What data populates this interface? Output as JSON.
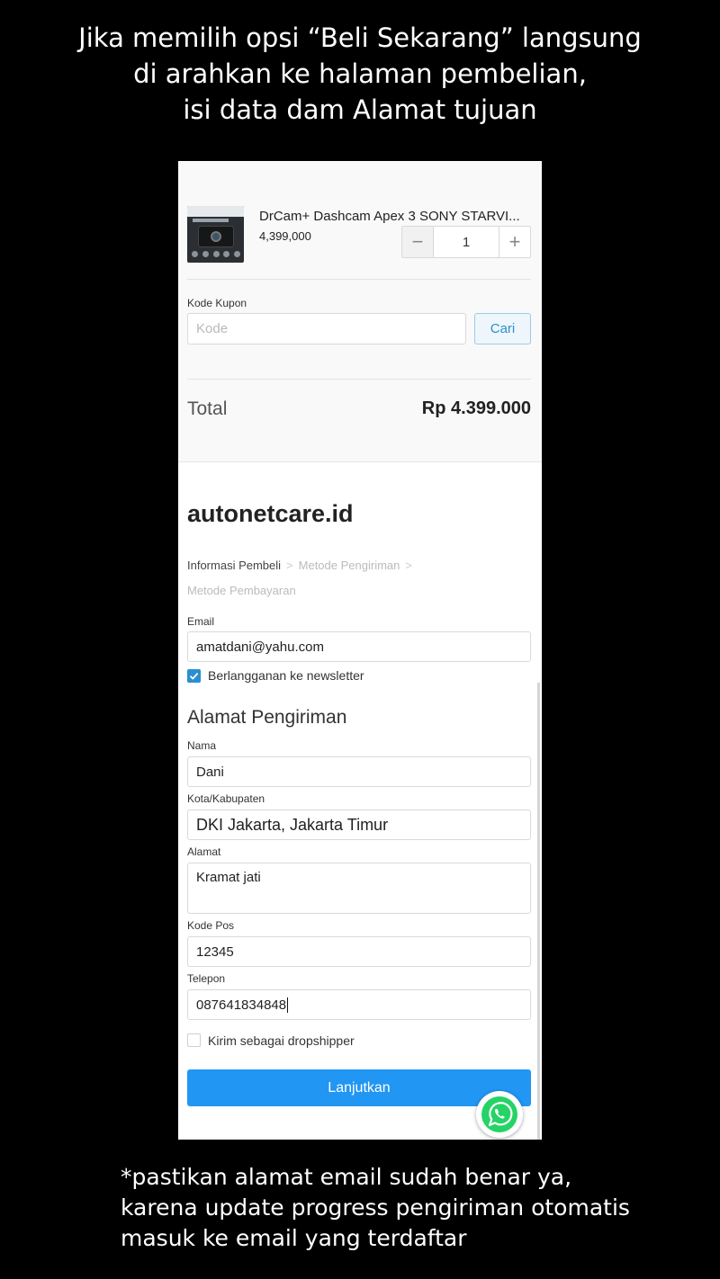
{
  "captions": {
    "top": [
      "Jika memilih opsi “Beli Sekarang” langsung",
      "di arahkan ke halaman pembelian,",
      "isi data dam Alamat tujuan"
    ],
    "bottom": [
      "*pastikan alamat email sudah benar ya,",
      "karena update progress pengiriman otomatis",
      "masuk ke email yang terdaftar"
    ]
  },
  "cart": {
    "product_name": "DrCam+ Dashcam Apex 3 SONY STARVI...",
    "product_price": "4,399,000",
    "quantity": "1",
    "minus_label": "−",
    "plus_label": "+",
    "coupon_label": "Kode Kupon",
    "coupon_placeholder": "Kode",
    "coupon_button": "Cari",
    "total_label": "Total",
    "total_value": "Rp 4.399.000"
  },
  "store": {
    "name": "autonetcare.id"
  },
  "steps": [
    "Informasi Pembeli",
    "Metode Pengiriman",
    "Metode Pembayaran"
  ],
  "form": {
    "email_label": "Email",
    "email_value": "amatdani@yahu.com",
    "newsletter_label": "Berlangganan ke newsletter",
    "newsletter_checked": true,
    "section_title": "Alamat Pengiriman",
    "name_label": "Nama",
    "name_value": "Dani",
    "city_label": "Kota/Kabupaten",
    "city_value": "DKI Jakarta, Jakarta Timur",
    "address_label": "Alamat",
    "address_value": "Kramat jati",
    "postal_label": "Kode Pos",
    "postal_value": "12345",
    "phone_label": "Telepon",
    "phone_value": "087641834848",
    "dropship_label": "Kirim sebagai dropshipper",
    "dropship_checked": false,
    "submit_label": "Lanjutkan"
  },
  "icons": {
    "whatsapp": "whatsapp-icon",
    "check": "checkmark-icon",
    "chevron": "chevron-right-icon"
  },
  "colors": {
    "primary": "#2196f3",
    "whatsapp": "#25d366",
    "link": "#2a8fd0"
  }
}
